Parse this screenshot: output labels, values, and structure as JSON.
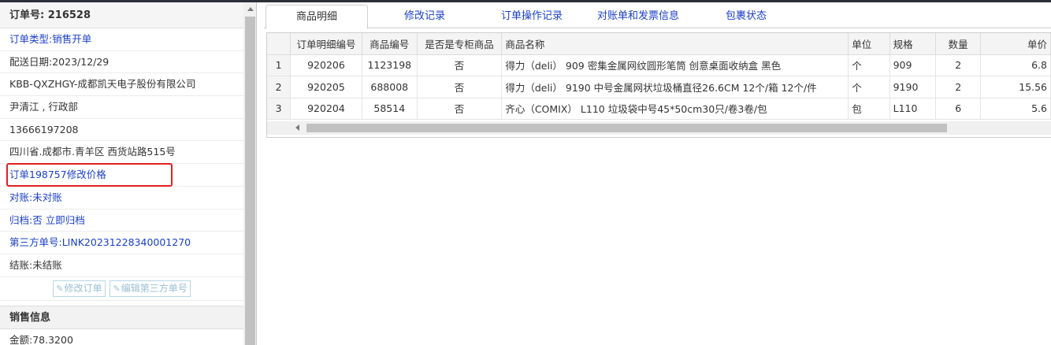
{
  "left_panel": {
    "order_header": "订单号: 216528",
    "fields": [
      {
        "label": "订单类型:",
        "value": "销售开单",
        "color": "blue"
      },
      {
        "label": "配送日期:",
        "value": "2023/12/29",
        "color": "dark"
      },
      {
        "label": "",
        "value": "KBB-QXZHGY-成都凯天电子股份有限公司",
        "color": "dark"
      },
      {
        "label": "",
        "value": "尹清江 , 行政部",
        "color": "dark"
      },
      {
        "label": "",
        "value": "13666197208",
        "color": "dark"
      },
      {
        "label": "",
        "value": "四川省.成都市.青羊区 西货站路515号",
        "color": "dark"
      },
      {
        "label": "",
        "value": "订单198757修改价格",
        "color": "blue"
      },
      {
        "label": "对账:",
        "value": "未对账",
        "color": "blue"
      },
      {
        "label": "归档:",
        "value": "否 立即归档",
        "color": "blue"
      },
      {
        "label": "第三方单号:",
        "value": "LINK20231228340001270",
        "color": "blue"
      },
      {
        "label": "结账:",
        "value": "未结账",
        "color": "dark"
      }
    ],
    "buttons": {
      "edit_order": "修改订单",
      "edit_third_party": "编辑第三方单号",
      "icon": "edit-icon"
    },
    "sales_section": {
      "title": "销售信息",
      "amount_label": "金额:",
      "amount_value": "78.3200"
    }
  },
  "tabs": [
    {
      "label": "商品明细",
      "active": true
    },
    {
      "label": "修改记录",
      "active": false
    },
    {
      "label": "订单操作记录",
      "active": false
    },
    {
      "label": "对账单和发票信息",
      "active": false
    },
    {
      "label": "包裹状态",
      "active": false
    }
  ],
  "grid": {
    "columns": [
      "",
      "订单明细编号",
      "商品编号",
      "是否是专柜商品",
      "商品名称",
      "单位",
      "规格",
      "数量",
      "单价"
    ],
    "rows": [
      [
        "1",
        "920206",
        "1123198",
        "否",
        "得力（deli） 909 密集金属网纹圆形笔筒 创意桌面收纳盒 黑色",
        "个",
        "909",
        "2",
        "6.8"
      ],
      [
        "2",
        "920205",
        "688008",
        "否",
        "得力（deli） 9190 中号金属网状垃圾桶直径26.6CM 12个/箱 12个/件",
        "个",
        "9190",
        "2",
        "15.56"
      ],
      [
        "3",
        "920204",
        "58514",
        "否",
        "齐心（COMIX） L110 垃圾袋中号45*50cm30只/卷3卷/包",
        "包",
        "L110",
        "6",
        "5.6"
      ]
    ]
  },
  "colors": {
    "link": "#1a3fc7",
    "highlight_border": "#e02020"
  }
}
